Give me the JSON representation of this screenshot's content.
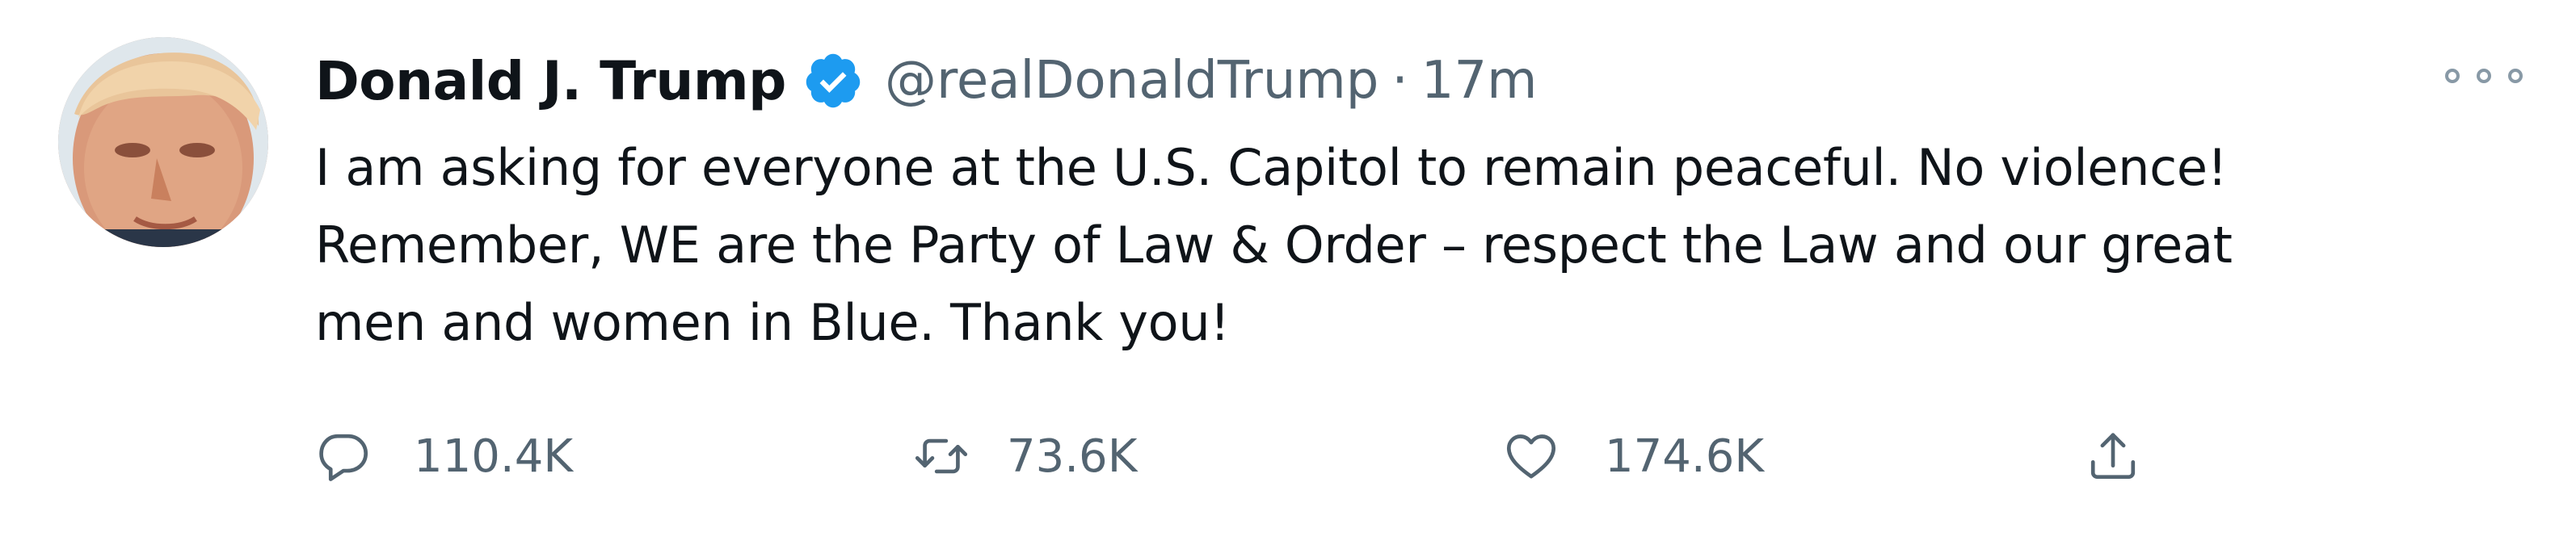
{
  "tweet": {
    "author": {
      "display_name": "Donald J. Trump",
      "handle": "@realDonaldTrump",
      "verified": true
    },
    "separator": "·",
    "timestamp": "17m",
    "text_lines": [
      "I am asking for everyone at the U.S. Capitol to remain peaceful. No violence!",
      "Remember, WE are the Party of Law & Order – respect the Law and our great",
      "men and women in Blue. Thank you!"
    ],
    "actions": {
      "reply_count": "110.4K",
      "retweet_count": "73.6K",
      "like_count": "174.6K"
    }
  },
  "icons": {
    "verified": "verified-badge-icon",
    "more": "more-options-icon",
    "reply": "reply-icon",
    "retweet": "retweet-icon",
    "like": "heart-icon",
    "share": "share-icon"
  },
  "colors": {
    "text_primary": "#0f1419",
    "text_secondary": "#536471",
    "verified_blue": "#1d9bf0",
    "background": "#ffffff"
  }
}
